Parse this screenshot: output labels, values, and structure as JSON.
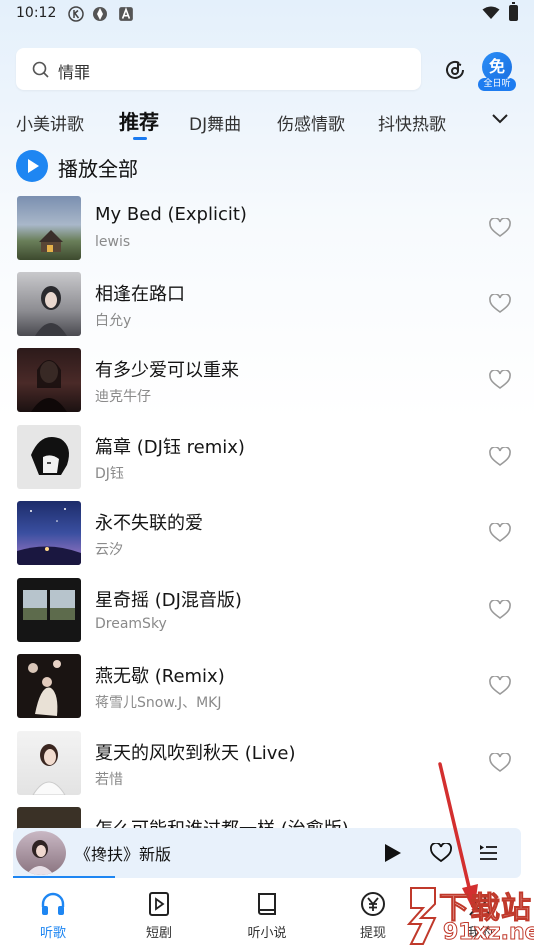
{
  "status_bar": {
    "time": "10:12"
  },
  "search": {
    "query": "情罪"
  },
  "vip": {
    "main": "免",
    "sub": "全日听"
  },
  "tabs": [
    {
      "label": "小美讲歌"
    },
    {
      "label": "推荐"
    },
    {
      "label": "DJ舞曲"
    },
    {
      "label": "伤感情歌"
    },
    {
      "label": "抖快热歌"
    }
  ],
  "play_all": {
    "label": "播放全部"
  },
  "songs": [
    {
      "title": "My Bed (Explicit)",
      "artist": "lewis"
    },
    {
      "title": "相逢在路口",
      "artist": "白允y"
    },
    {
      "title": "有多少爱可以重来",
      "artist": "迪克牛仔"
    },
    {
      "title": "篇章 (DJ钰 remix)",
      "artist": "DJ钰"
    },
    {
      "title": "永不失联的爱",
      "artist": "云汐"
    },
    {
      "title": "星奇摇 (DJ混音版)",
      "artist": "DreamSky"
    },
    {
      "title": "燕无歇 (Remix)",
      "artist": "蒋雪儿Snow.J、MKJ"
    },
    {
      "title": "夏天的风吹到秋天 (Live)",
      "artist": "若惜"
    },
    {
      "title": "怎么可能和谁过都一样 (治愈版)",
      "artist": ""
    }
  ],
  "mini_player": {
    "title": "《搀扶》新版",
    "progress": 0.2
  },
  "bottom_nav": [
    {
      "label": "听歌",
      "icon": "headphones-icon"
    },
    {
      "label": "短剧",
      "icon": "video-icon"
    },
    {
      "label": "听小说",
      "icon": "book-icon"
    },
    {
      "label": "提现",
      "icon": "yuan-icon"
    },
    {
      "label": "我的",
      "icon": "user-icon"
    }
  ],
  "watermark": {
    "line1": "下载站",
    "line2": "91xz.net"
  },
  "colors": {
    "accent": "#1e86f2",
    "annotation": "#d32f2f"
  }
}
